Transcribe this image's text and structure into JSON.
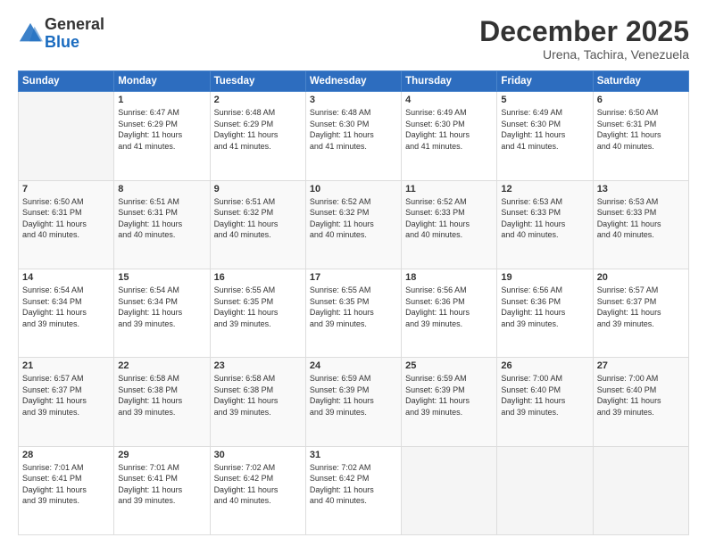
{
  "header": {
    "logo_general": "General",
    "logo_blue": "Blue",
    "month_title": "December 2025",
    "location": "Urena, Tachira, Venezuela"
  },
  "calendar": {
    "headers": [
      "Sunday",
      "Monday",
      "Tuesday",
      "Wednesday",
      "Thursday",
      "Friday",
      "Saturday"
    ],
    "weeks": [
      [
        {
          "day": "",
          "info": ""
        },
        {
          "day": "1",
          "info": "Sunrise: 6:47 AM\nSunset: 6:29 PM\nDaylight: 11 hours\nand 41 minutes."
        },
        {
          "day": "2",
          "info": "Sunrise: 6:48 AM\nSunset: 6:29 PM\nDaylight: 11 hours\nand 41 minutes."
        },
        {
          "day": "3",
          "info": "Sunrise: 6:48 AM\nSunset: 6:30 PM\nDaylight: 11 hours\nand 41 minutes."
        },
        {
          "day": "4",
          "info": "Sunrise: 6:49 AM\nSunset: 6:30 PM\nDaylight: 11 hours\nand 41 minutes."
        },
        {
          "day": "5",
          "info": "Sunrise: 6:49 AM\nSunset: 6:30 PM\nDaylight: 11 hours\nand 41 minutes."
        },
        {
          "day": "6",
          "info": "Sunrise: 6:50 AM\nSunset: 6:31 PM\nDaylight: 11 hours\nand 40 minutes."
        }
      ],
      [
        {
          "day": "7",
          "info": "Sunrise: 6:50 AM\nSunset: 6:31 PM\nDaylight: 11 hours\nand 40 minutes."
        },
        {
          "day": "8",
          "info": "Sunrise: 6:51 AM\nSunset: 6:31 PM\nDaylight: 11 hours\nand 40 minutes."
        },
        {
          "day": "9",
          "info": "Sunrise: 6:51 AM\nSunset: 6:32 PM\nDaylight: 11 hours\nand 40 minutes."
        },
        {
          "day": "10",
          "info": "Sunrise: 6:52 AM\nSunset: 6:32 PM\nDaylight: 11 hours\nand 40 minutes."
        },
        {
          "day": "11",
          "info": "Sunrise: 6:52 AM\nSunset: 6:33 PM\nDaylight: 11 hours\nand 40 minutes."
        },
        {
          "day": "12",
          "info": "Sunrise: 6:53 AM\nSunset: 6:33 PM\nDaylight: 11 hours\nand 40 minutes."
        },
        {
          "day": "13",
          "info": "Sunrise: 6:53 AM\nSunset: 6:33 PM\nDaylight: 11 hours\nand 40 minutes."
        }
      ],
      [
        {
          "day": "14",
          "info": "Sunrise: 6:54 AM\nSunset: 6:34 PM\nDaylight: 11 hours\nand 39 minutes."
        },
        {
          "day": "15",
          "info": "Sunrise: 6:54 AM\nSunset: 6:34 PM\nDaylight: 11 hours\nand 39 minutes."
        },
        {
          "day": "16",
          "info": "Sunrise: 6:55 AM\nSunset: 6:35 PM\nDaylight: 11 hours\nand 39 minutes."
        },
        {
          "day": "17",
          "info": "Sunrise: 6:55 AM\nSunset: 6:35 PM\nDaylight: 11 hours\nand 39 minutes."
        },
        {
          "day": "18",
          "info": "Sunrise: 6:56 AM\nSunset: 6:36 PM\nDaylight: 11 hours\nand 39 minutes."
        },
        {
          "day": "19",
          "info": "Sunrise: 6:56 AM\nSunset: 6:36 PM\nDaylight: 11 hours\nand 39 minutes."
        },
        {
          "day": "20",
          "info": "Sunrise: 6:57 AM\nSunset: 6:37 PM\nDaylight: 11 hours\nand 39 minutes."
        }
      ],
      [
        {
          "day": "21",
          "info": "Sunrise: 6:57 AM\nSunset: 6:37 PM\nDaylight: 11 hours\nand 39 minutes."
        },
        {
          "day": "22",
          "info": "Sunrise: 6:58 AM\nSunset: 6:38 PM\nDaylight: 11 hours\nand 39 minutes."
        },
        {
          "day": "23",
          "info": "Sunrise: 6:58 AM\nSunset: 6:38 PM\nDaylight: 11 hours\nand 39 minutes."
        },
        {
          "day": "24",
          "info": "Sunrise: 6:59 AM\nSunset: 6:39 PM\nDaylight: 11 hours\nand 39 minutes."
        },
        {
          "day": "25",
          "info": "Sunrise: 6:59 AM\nSunset: 6:39 PM\nDaylight: 11 hours\nand 39 minutes."
        },
        {
          "day": "26",
          "info": "Sunrise: 7:00 AM\nSunset: 6:40 PM\nDaylight: 11 hours\nand 39 minutes."
        },
        {
          "day": "27",
          "info": "Sunrise: 7:00 AM\nSunset: 6:40 PM\nDaylight: 11 hours\nand 39 minutes."
        }
      ],
      [
        {
          "day": "28",
          "info": "Sunrise: 7:01 AM\nSunset: 6:41 PM\nDaylight: 11 hours\nand 39 minutes."
        },
        {
          "day": "29",
          "info": "Sunrise: 7:01 AM\nSunset: 6:41 PM\nDaylight: 11 hours\nand 39 minutes."
        },
        {
          "day": "30",
          "info": "Sunrise: 7:02 AM\nSunset: 6:42 PM\nDaylight: 11 hours\nand 40 minutes."
        },
        {
          "day": "31",
          "info": "Sunrise: 7:02 AM\nSunset: 6:42 PM\nDaylight: 11 hours\nand 40 minutes."
        },
        {
          "day": "",
          "info": ""
        },
        {
          "day": "",
          "info": ""
        },
        {
          "day": "",
          "info": ""
        }
      ]
    ]
  }
}
